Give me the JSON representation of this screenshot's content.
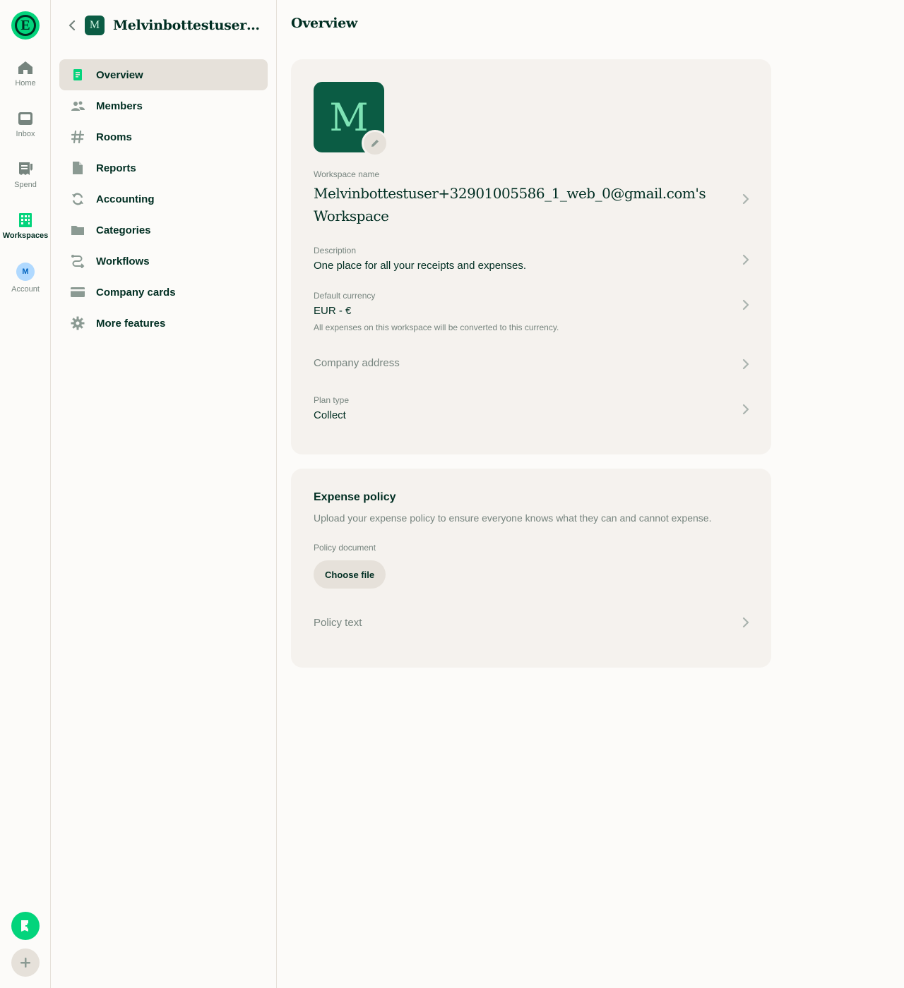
{
  "rail": {
    "items": [
      {
        "label": "Home",
        "icon": "home-icon"
      },
      {
        "label": "Inbox",
        "icon": "inbox-icon"
      },
      {
        "label": "Spend",
        "icon": "receipt-icon"
      },
      {
        "label": "Workspaces",
        "icon": "building-icon"
      },
      {
        "label": "Account",
        "avatar": "M"
      }
    ],
    "active": "Workspaces"
  },
  "sidebar": {
    "workspace_avatar": "M",
    "workspace_title": "Melvinbottestuser+3...",
    "items": [
      {
        "label": "Overview",
        "icon": "document-icon"
      },
      {
        "label": "Members",
        "icon": "users-icon"
      },
      {
        "label": "Rooms",
        "icon": "hashtag-icon"
      },
      {
        "label": "Reports",
        "icon": "file-icon"
      },
      {
        "label": "Accounting",
        "icon": "sync-icon"
      },
      {
        "label": "Categories",
        "icon": "folder-icon"
      },
      {
        "label": "Workflows",
        "icon": "workflow-icon"
      },
      {
        "label": "Company cards",
        "icon": "credit-card-icon"
      },
      {
        "label": "More features",
        "icon": "gear-icon"
      }
    ],
    "active": "Overview"
  },
  "main": {
    "title": "Overview",
    "avatar_letter": "M",
    "workspace_name_label": "Workspace name",
    "workspace_name": "Melvinbottestuser+32901005586_1_web_0@gmail.com's Workspace",
    "description_label": "Description",
    "description": "One place for all your receipts and expenses.",
    "currency_label": "Default currency",
    "currency": "EUR - €",
    "currency_hint": "All expenses on this workspace will be converted to this currency.",
    "company_address": "Company address",
    "plan_label": "Plan type",
    "plan": "Collect"
  },
  "policy": {
    "title": "Expense policy",
    "subtitle": "Upload your expense policy to ensure everyone knows what they can and cannot expense.",
    "document_label": "Policy document",
    "choose_file": "Choose file",
    "policy_text": "Policy text"
  },
  "colors": {
    "accent": "#03d47c",
    "text": "#002e22",
    "muted": "#76847e",
    "card": "#f5f2ee",
    "avatar_bg": "#0b5c44"
  }
}
